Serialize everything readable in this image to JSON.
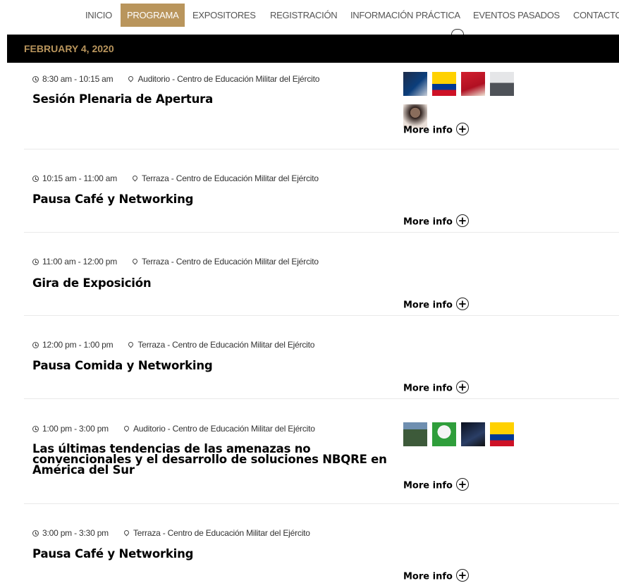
{
  "nav": {
    "items": [
      {
        "label": "INICIO",
        "active": false
      },
      {
        "label": "PROGRAMA",
        "active": true
      },
      {
        "label": "EXPOSITORES",
        "active": false
      },
      {
        "label": "REGISTRACIÓN",
        "active": false
      },
      {
        "label": "INFORMACIÓN PRÁCTICA",
        "active": false
      },
      {
        "label": "EVENTOS PASADOS",
        "active": false
      },
      {
        "label": "CONTACTO",
        "active": false
      }
    ]
  },
  "date_header": "FEBRUARY 4, 2020",
  "more_info_label": "More info",
  "sessions": [
    {
      "time": "8:30 am - 10:15 am",
      "location": "Auditorio - Centro de Educación Militar del Ejército",
      "title": "Sesión Plenaria de Apertura"
    },
    {
      "time": "10:15 am - 11:00 am",
      "location": "Terraza - Centro de Educación Militar del Ejército",
      "title": "Pausa Café y Networking"
    },
    {
      "time": "11:00 am - 12:00 pm",
      "location": "Terraza - Centro de Educación Militar del Ejército",
      "title": "Gira de Exposición"
    },
    {
      "time": "12:00 pm - 1:00 pm",
      "location": "Terraza - Centro de Educación Militar del Ejército",
      "title": "Pausa Comida y Networking"
    },
    {
      "time": "1:00 pm - 3:00 pm",
      "location": "Auditorio - Centro de Educación Militar del Ejército",
      "title_lines": [
        "Las últimas tendencias de las amenazas no",
        "convencionales y el desarrollo de soluciones NBQRE en",
        "América del Sur"
      ]
    },
    {
      "time": "3:00 pm - 3:30 pm",
      "location": "Terraza - Centro de Educación Militar del Ejército",
      "title": "Pausa Café y Networking"
    }
  ],
  "colors": {
    "accent": "#b9955c",
    "date_bar": "#000000"
  }
}
